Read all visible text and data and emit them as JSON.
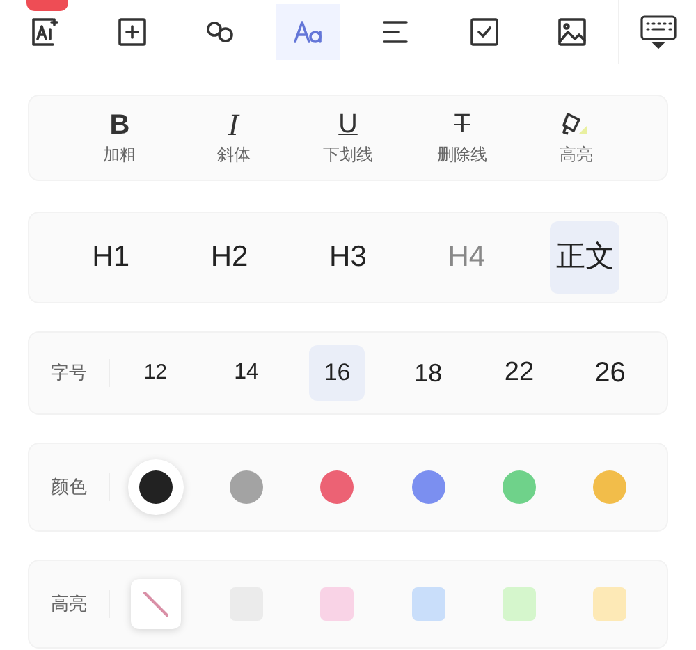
{
  "toolbar": {
    "items": [
      {
        "kind": "ai",
        "selected": false,
        "badge": true
      },
      {
        "kind": "add",
        "selected": false,
        "badge": false
      },
      {
        "kind": "link",
        "selected": false,
        "badge": false
      },
      {
        "kind": "text",
        "selected": true,
        "badge": false
      },
      {
        "kind": "align",
        "selected": false,
        "badge": false
      },
      {
        "kind": "check",
        "selected": false,
        "badge": false
      },
      {
        "kind": "image",
        "selected": false,
        "badge": false
      }
    ],
    "keyboard_button": {
      "kind": "keyboard"
    }
  },
  "format": [
    {
      "kind": "bold",
      "icon": "B",
      "label": "加粗"
    },
    {
      "kind": "italic",
      "icon": "I",
      "label": "斜体"
    },
    {
      "kind": "underline",
      "icon": "U",
      "label": "下划线"
    },
    {
      "kind": "strike",
      "icon": "T",
      "label": "删除线"
    },
    {
      "kind": "highlight",
      "label": "高亮"
    }
  ],
  "headings": [
    {
      "label": "H1",
      "selected": false,
      "disabled": false
    },
    {
      "label": "H2",
      "selected": false,
      "disabled": false
    },
    {
      "label": "H3",
      "selected": false,
      "disabled": false
    },
    {
      "label": "H4",
      "selected": false,
      "disabled": true
    },
    {
      "label": "正文",
      "selected": true,
      "disabled": false
    }
  ],
  "font_size": {
    "label": "字号",
    "options": [
      {
        "label": "12",
        "selected": false
      },
      {
        "label": "14",
        "selected": false
      },
      {
        "label": "16",
        "selected": true
      },
      {
        "label": "18",
        "selected": false
      },
      {
        "label": "22",
        "selected": false
      },
      {
        "label": "26",
        "selected": false
      }
    ]
  },
  "text_color": {
    "label": "颜色",
    "options": [
      {
        "color": "#222222",
        "selected": true
      },
      {
        "color": "#a3a3a3",
        "selected": false
      },
      {
        "color": "#ec6274",
        "selected": false
      },
      {
        "color": "#7b8ff0",
        "selected": false
      },
      {
        "color": "#6fd28a",
        "selected": false
      },
      {
        "color": "#f2bd4a",
        "selected": false
      }
    ]
  },
  "highlight": {
    "label": "高亮",
    "options": [
      {
        "kind": "none",
        "selected": true
      },
      {
        "kind": "swatch",
        "color": "#ebebeb",
        "selected": false
      },
      {
        "kind": "swatch",
        "color": "#f9d3e6",
        "selected": false
      },
      {
        "kind": "swatch",
        "color": "#c9defa",
        "selected": false
      },
      {
        "kind": "swatch",
        "color": "#d5f6cc",
        "selected": false
      },
      {
        "kind": "swatch",
        "color": "#fde9b6",
        "selected": false
      }
    ]
  }
}
